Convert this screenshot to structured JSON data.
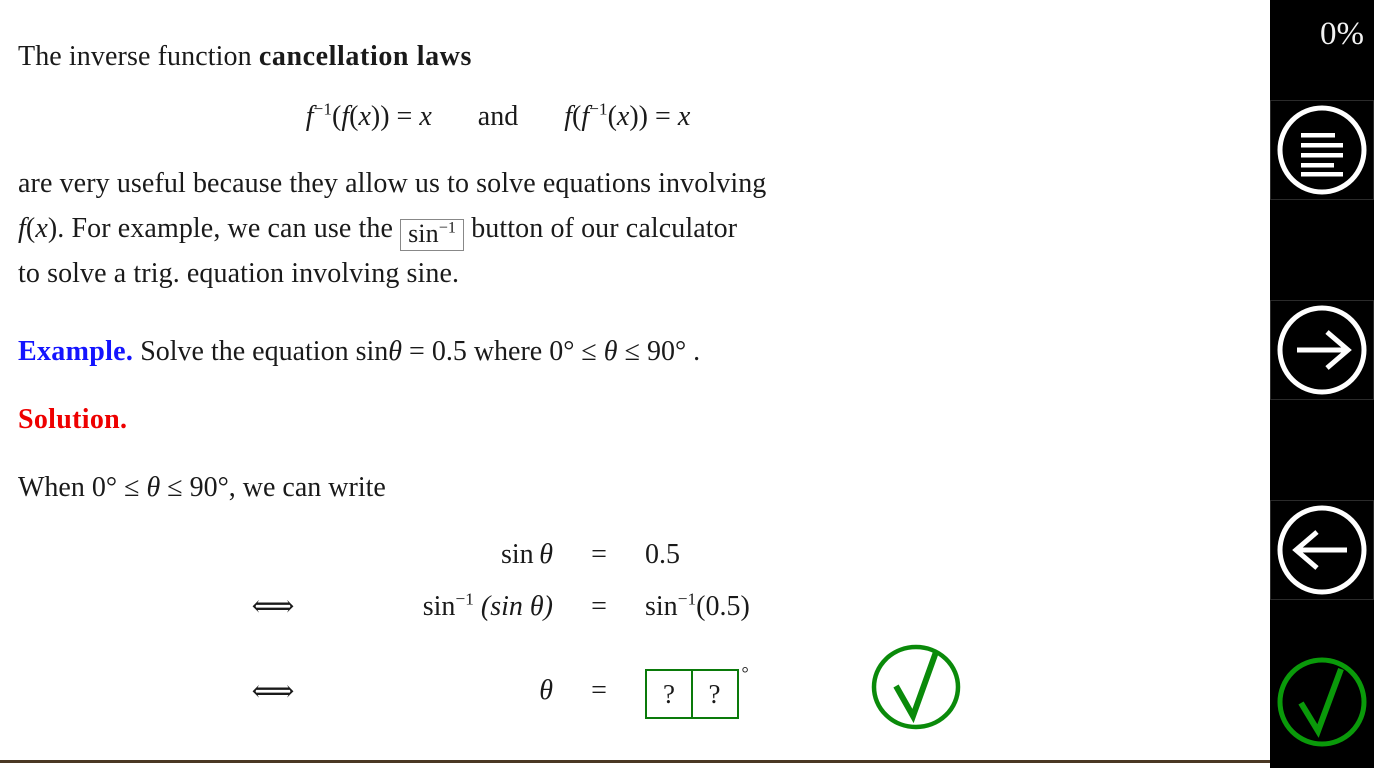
{
  "slide": {
    "intro": {
      "text_before_bold": "The inverse function ",
      "bold_term": "cancellation laws"
    },
    "cancellation_identity": {
      "first": "f⁻¹(f(x)) = x",
      "conjunction": "and",
      "second": "f(f⁻¹(x)) = x",
      "f_label": "f",
      "exp_label": "−1",
      "x_label": "x",
      "eq_label": "="
    },
    "body_paragraph": {
      "line1": "are very useful because they allow us to solve equations involving",
      "line2_a": "f(x)",
      "line2_b": ". For example, we can use the",
      "boxed_button": "sin",
      "boxed_button_exp": "−1",
      "line2_c": "button of our calculator",
      "line3": "to solve a trig. equation involving sine."
    },
    "example": {
      "keyword": "Example.",
      "text_a": "Solve the equation sin",
      "theta": "θ",
      "text_b": "= 0.5 where 0°",
      "le1": "≤",
      "theta2": "θ",
      "le2": "≤",
      "text_c": "90° ."
    },
    "solution": {
      "keyword": "Solution.",
      "when_line_a": "When 0°",
      "when_le1": "≤",
      "when_theta": "θ",
      "when_le2": "≤",
      "when_line_b": "90°, we can write"
    },
    "derivation": {
      "rows": [
        {
          "implies": "",
          "lhs_sin": "sin",
          "lhs_theta": "θ",
          "lhs_type": "sin-theta",
          "eq": "=",
          "rhs": "0.5",
          "rhs_type": "plain"
        },
        {
          "implies": "⟺",
          "lhs_sin": "sin",
          "lhs_exp": "−1",
          "lhs_inner": "(sin θ)",
          "lhs_type": "arcsin-of-sin",
          "eq": "=",
          "rhs_sin": "sin",
          "rhs_exp": "−1",
          "rhs_arg": "(0.5)",
          "rhs_type": "arcsin-value"
        },
        {
          "implies": "⟺",
          "lhs_theta": "θ",
          "lhs_type": "theta",
          "eq": "=",
          "rhs_type": "answer-boxes",
          "answer_box_1": "?",
          "answer_box_2": "?",
          "degree": "°"
        }
      ]
    },
    "check_icon_label": "check-mark"
  },
  "sidebar": {
    "progress_label": "0%",
    "buttons": [
      {
        "name": "menu-button",
        "icon": "lines-menu-icon",
        "color": "#ffffff"
      },
      {
        "name": "next-button",
        "icon": "arrow-right-icon",
        "color": "#ffffff"
      },
      {
        "name": "previous-button",
        "icon": "arrow-left-icon",
        "color": "#ffffff"
      },
      {
        "name": "check-answer-button",
        "icon": "check-circle-icon",
        "color": "#0a9a0a"
      }
    ]
  },
  "colors": {
    "example_blue": "#1414ff",
    "solution_red": "#ee0000",
    "answer_green": "#0a7a0a",
    "check_green": "#0a9a0a",
    "sidebar_background": "#000000",
    "bottom_rule": "#4a3823",
    "slide_background": "#ffffff"
  }
}
